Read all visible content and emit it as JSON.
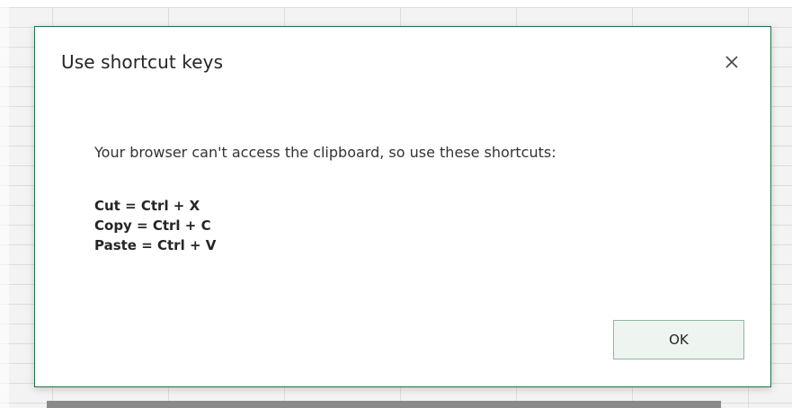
{
  "dialog": {
    "title": "Use shortcut keys",
    "close_icon": "close-icon",
    "message": "Your browser can't access the clipboard, so use these shortcuts:",
    "shortcuts": [
      "Cut = Ctrl + X",
      "Copy = Ctrl + C",
      "Paste = Ctrl + V"
    ],
    "ok_label": "OK"
  },
  "colors": {
    "accent": "#217346",
    "button_bg": "#eef5f0",
    "button_border": "#8fb8a0",
    "grid_line": "#dcdcdc"
  }
}
